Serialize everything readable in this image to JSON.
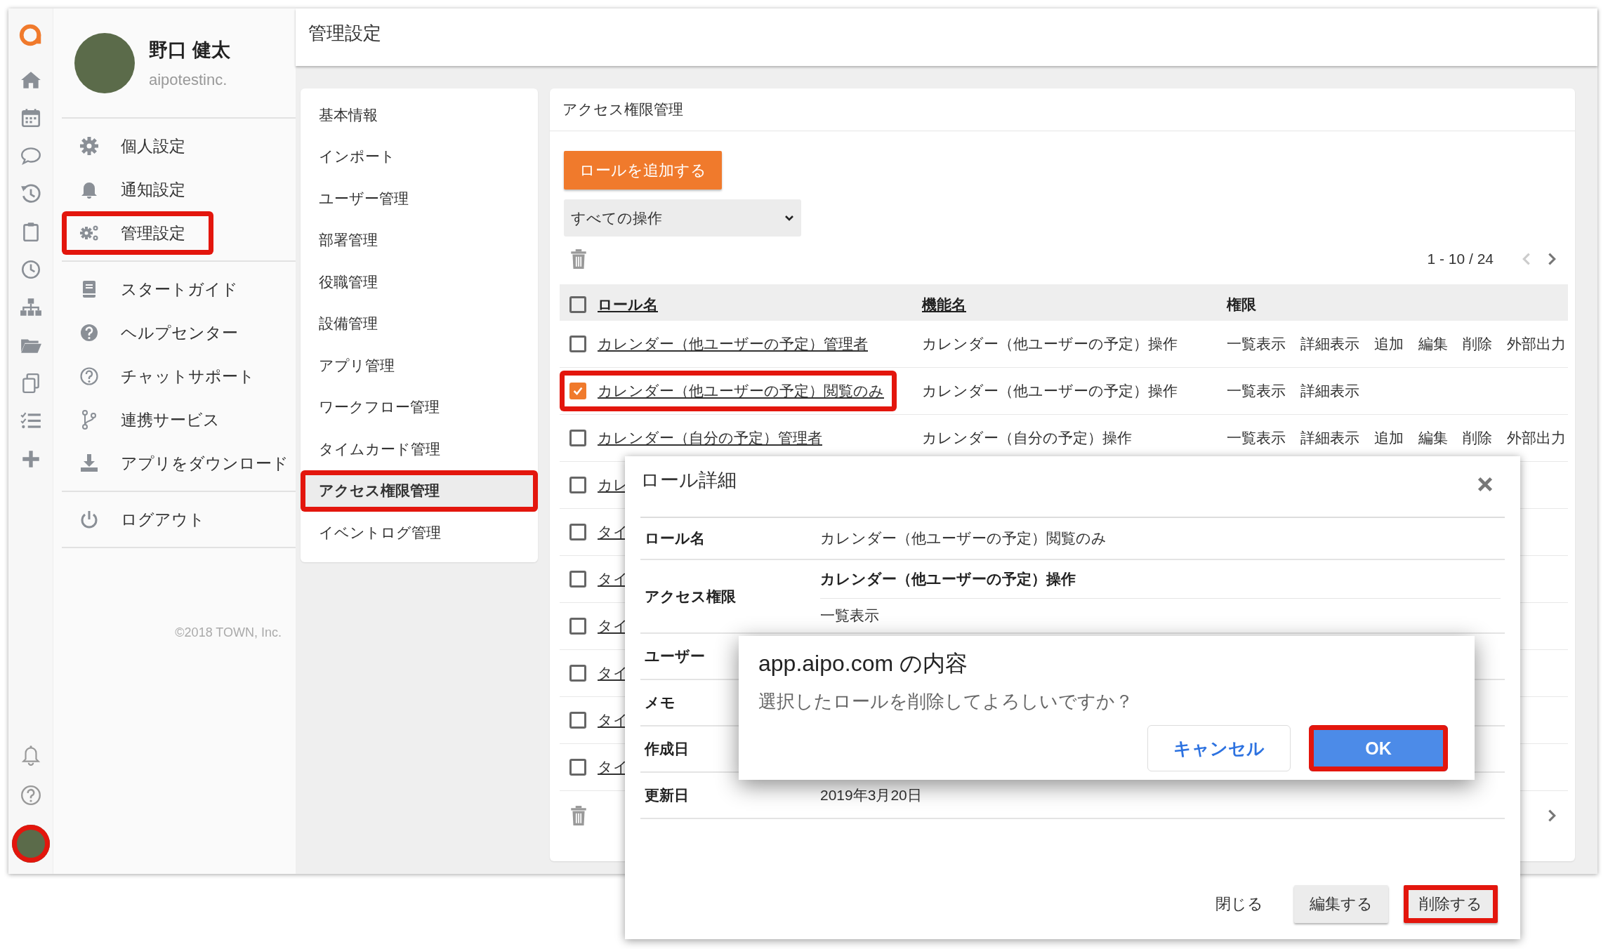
{
  "profile": {
    "name": "野口 健太",
    "company": "aipotestinc."
  },
  "rail": {
    "avatar_highlighted": true
  },
  "menu_groups": [
    [
      {
        "label": "個人設定",
        "kind": "gear",
        "highlighted": false
      },
      {
        "label": "通知設定",
        "kind": "bell",
        "highlighted": false
      },
      {
        "label": "管理設定",
        "kind": "gears",
        "highlighted": true
      }
    ],
    [
      {
        "label": "スタートガイド",
        "kind": "book",
        "highlighted": false
      },
      {
        "label": "ヘルプセンター",
        "kind": "help",
        "highlighted": false
      },
      {
        "label": "チャットサポート",
        "kind": "help-outline",
        "highlighted": false
      },
      {
        "label": "連携サービス",
        "kind": "branch",
        "highlighted": false
      },
      {
        "label": "アプリをダウンロード",
        "kind": "download",
        "highlighted": false
      }
    ],
    [
      {
        "label": "ログアウト",
        "kind": "power",
        "highlighted": false
      }
    ]
  ],
  "copyright": "©2018 TOWN, Inc.",
  "header": {
    "title": "管理設定"
  },
  "submenu": [
    {
      "label": "基本情報",
      "selected": false,
      "highlighted": false
    },
    {
      "label": "インポート",
      "selected": false,
      "highlighted": false
    },
    {
      "label": "ユーザー管理",
      "selected": false,
      "highlighted": false
    },
    {
      "label": "部署管理",
      "selected": false,
      "highlighted": false
    },
    {
      "label": "役職管理",
      "selected": false,
      "highlighted": false
    },
    {
      "label": "設備管理",
      "selected": false,
      "highlighted": false
    },
    {
      "label": "アプリ管理",
      "selected": false,
      "highlighted": false
    },
    {
      "label": "ワークフロー管理",
      "selected": false,
      "highlighted": false
    },
    {
      "label": "タイムカード管理",
      "selected": false,
      "highlighted": false
    },
    {
      "label": "アクセス権限管理",
      "selected": true,
      "highlighted": true
    },
    {
      "label": "イベントログ管理",
      "selected": false,
      "highlighted": false
    }
  ],
  "panel": {
    "title": "アクセス権限管理",
    "add_button": "ロールを追加する",
    "filter": {
      "value": "すべての操作"
    },
    "pagination": {
      "range": "1 - 10 / 24"
    },
    "table": {
      "header_checked": false,
      "columns": [
        "ロール名",
        "機能名",
        "権限"
      ],
      "rows": [
        {
          "checked": false,
          "highlighted": false,
          "role": "カレンダー（他ユーザーの予定）管理者",
          "function": "カレンダー（他ユーザーの予定）操作",
          "permissions": [
            "一覧表示",
            "詳細表示",
            "追加",
            "編集",
            "削除",
            "外部出力"
          ]
        },
        {
          "checked": true,
          "highlighted": true,
          "role": "カレンダー（他ユーザーの予定）閲覧のみ",
          "function": "カレンダー（他ユーザーの予定）操作",
          "permissions": [
            "一覧表示",
            "詳細表示"
          ]
        },
        {
          "checked": false,
          "highlighted": false,
          "role": "カレンダー（自分の予定）管理者",
          "function": "カレンダー（自分の予定）操作",
          "permissions": [
            "一覧表示",
            "詳細表示",
            "追加",
            "編集",
            "削除",
            "外部出力"
          ]
        },
        {
          "checked": false,
          "role": "カレ"
        },
        {
          "checked": false,
          "role": "タイ"
        },
        {
          "checked": false,
          "role": "タイ"
        },
        {
          "checked": false,
          "role": "タイ"
        },
        {
          "checked": false,
          "role": "タイ"
        },
        {
          "checked": false,
          "role": "タイ"
        },
        {
          "checked": false,
          "role": "タイ"
        }
      ]
    }
  },
  "role_detail": {
    "title": "ロール詳細",
    "fields": [
      {
        "label": "ロール名",
        "kind": "text",
        "value": "カレンダー（他ユーザーの予定）閲覧のみ"
      },
      {
        "label": "アクセス権限",
        "kind": "permissions",
        "function": "カレンダー（他ユーザーの予定）操作",
        "permissions": [
          "一覧表示"
        ]
      },
      {
        "label": "ユーザー",
        "kind": "text"
      },
      {
        "label": "メモ",
        "kind": "text"
      },
      {
        "label": "作成日",
        "kind": "text"
      },
      {
        "label": "更新日",
        "kind": "text",
        "value": "2019年3月20日"
      }
    ],
    "buttons": [
      {
        "label": "閉じる",
        "kind": "flat",
        "highlighted": false
      },
      {
        "label": "編集する",
        "kind": "raised",
        "highlighted": false
      },
      {
        "label": "削除する",
        "kind": "raised",
        "highlighted": true
      }
    ]
  },
  "confirm_dialog": {
    "title": "app.aipo.com の内容",
    "message": "選択したロールを削除してよろしいですか？",
    "buttons": [
      {
        "label": "キャンセル",
        "kind": "secondary",
        "highlighted": false
      },
      {
        "label": "OK",
        "kind": "primary",
        "highlighted": true
      }
    ]
  }
}
